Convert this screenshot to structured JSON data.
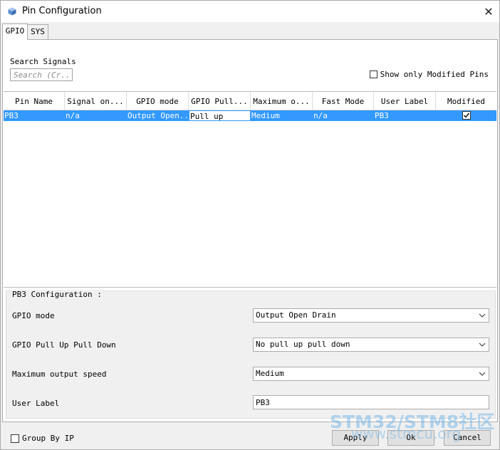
{
  "window": {
    "title": "Pin Configuration",
    "close_label": "✕"
  },
  "tabs": [
    {
      "label": "GPIO",
      "active": true
    },
    {
      "label": "SYS",
      "active": false
    }
  ],
  "search": {
    "label": "Search Signals",
    "placeholder": "Search (Cr..."
  },
  "modified_only": {
    "label": "Show only Modified Pins",
    "checked": false
  },
  "table": {
    "columns": [
      "Pin Name",
      "Signal on...",
      "GPIO mode",
      "GPIO Pull...",
      "Maximum o...",
      "Fast Mode",
      "User Label",
      "Modified"
    ],
    "sort_indicator": "^",
    "rows": [
      {
        "pin_name": "PB3",
        "signal": "n/a",
        "gpio_mode": "Output Open...",
        "gpio_pull": "Pull up",
        "max_speed": "Medium",
        "fast_mode": "n/a",
        "user_label": "PB3",
        "modified": true
      }
    ]
  },
  "config": {
    "title": "PB3 Configuration :",
    "gpio_mode": {
      "label": "GPIO mode",
      "value": "Output Open Drain"
    },
    "pull": {
      "label": "GPIO Pull Up Pull Down",
      "value": "No pull up pull down"
    },
    "speed": {
      "label": "Maximum output speed",
      "value": "Medium"
    },
    "user_label": {
      "label": "User Label",
      "value": "PB3"
    }
  },
  "group_by_ip": {
    "label": "Group By IP",
    "checked": false
  },
  "buttons": {
    "apply": "Apply",
    "ok": "Ok",
    "cancel": "Cancel"
  },
  "watermark": {
    "main": "STM32/STM8社区",
    "sub": "www.stmcu.org"
  },
  "colors": {
    "selection": "#3399ff",
    "window_bg": "#f0f0f0",
    "watermark": "#7ab8e8"
  }
}
